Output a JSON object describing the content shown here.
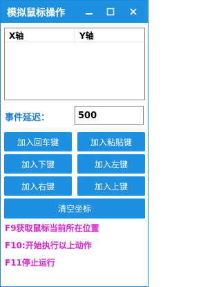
{
  "window": {
    "title": "模拟鼠标操作"
  },
  "titlebar_buttons": [
    {
      "icon": "minimize-icon"
    },
    {
      "icon": "maximize-icon"
    },
    {
      "icon": "close-icon"
    }
  ],
  "listview": {
    "columns": [
      "X轴",
      "Y轴"
    ],
    "rows": []
  },
  "delay": {
    "label": "事件延迟：",
    "value": "500"
  },
  "buttons": {
    "add_enter": "加入回车键",
    "add_paste": "加入粘贴键",
    "add_down": "加入下键",
    "add_left": "加入左键",
    "add_right": "加入右键",
    "add_up": "加入上键",
    "clear": "清空坐标"
  },
  "hotkeys": [
    "F9获取鼠标当前所在位置",
    "F10:开始执行以上动作",
    "F11停止运行"
  ],
  "colors": {
    "accent": "#1f8fe0",
    "label_blue": "#1a7fd4",
    "hotkey_magenta": "#e01fd0"
  }
}
